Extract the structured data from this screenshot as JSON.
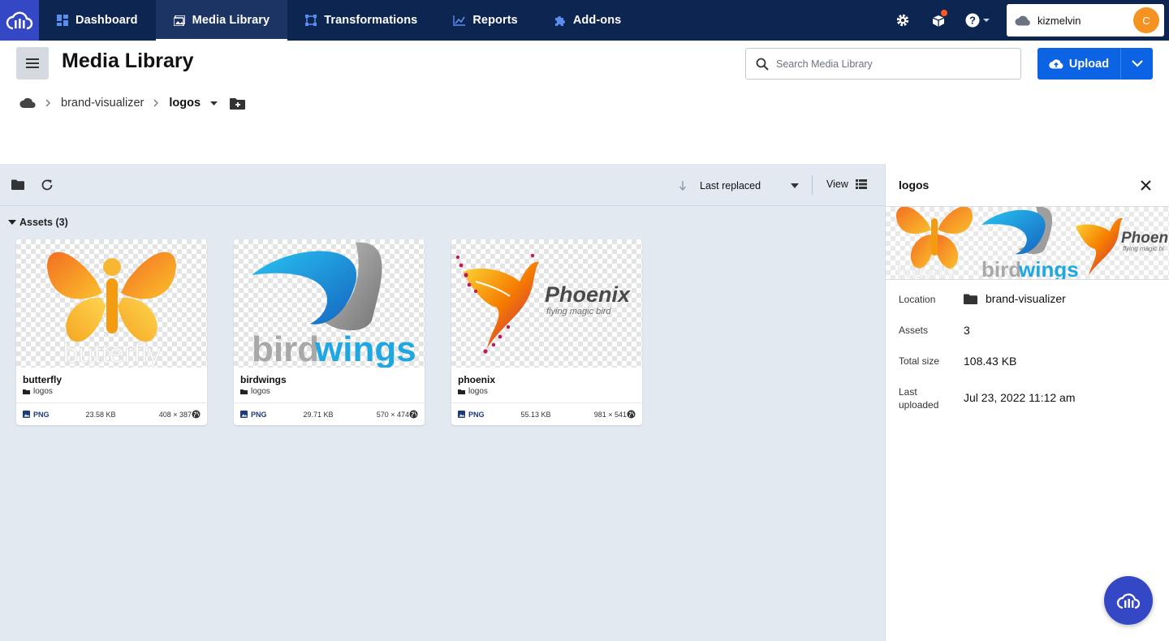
{
  "nav": {
    "tabs": [
      {
        "label": "Dashboard",
        "icon": "dashboard-icon"
      },
      {
        "label": "Media Library",
        "icon": "media-library-icon"
      },
      {
        "label": "Transformations",
        "icon": "transformations-icon"
      },
      {
        "label": "Reports",
        "icon": "reports-icon"
      },
      {
        "label": "Add-ons",
        "icon": "puzzle-icon"
      }
    ],
    "active_tab": "Media Library",
    "account": {
      "name": "kizmelvin",
      "avatar_initial": "C"
    }
  },
  "header": {
    "title": "Media Library",
    "search_placeholder": "Search Media Library",
    "upload_label": "Upload"
  },
  "breadcrumb": {
    "items": [
      "brand-visualizer",
      "logos"
    ]
  },
  "toolbar": {
    "sort_label": "Last replaced",
    "view_label": "View"
  },
  "assets": {
    "header": "Assets (3)",
    "items": [
      {
        "name": "butterfly",
        "folder": "logos",
        "format": "PNG",
        "size": "23.58 KB",
        "dimensions": "408 × 387",
        "logo_text": "butterfly"
      },
      {
        "name": "birdwings",
        "folder": "logos",
        "format": "PNG",
        "size": "29.71 KB",
        "dimensions": "570 × 474",
        "logo_text_a": "bird",
        "logo_text_b": "wings"
      },
      {
        "name": "phoenix",
        "folder": "logos",
        "format": "PNG",
        "size": "55.13 KB",
        "dimensions": "981 × 541",
        "logo_text": "Phoenix",
        "logo_tagline": "flying magic bird"
      }
    ]
  },
  "panel": {
    "title": "logos",
    "preview_text": {
      "butterfly": "butterfly",
      "bird": "bird",
      "wings": "wings",
      "phoenix": "Phoen",
      "tagline": "flying magic bi"
    },
    "rows": [
      {
        "label": "Location",
        "value": "brand-visualizer"
      },
      {
        "label": "Assets",
        "value": "3"
      },
      {
        "label": "Total size",
        "value": "108.43 KB"
      },
      {
        "label": "Last uploaded",
        "value": "Jul 23, 2022 11:12 am"
      }
    ]
  },
  "colors": {
    "nav_bg": "#0d2551",
    "brand": "#3448c5",
    "primary": "#0c63e4",
    "avatar": "#f59322"
  }
}
